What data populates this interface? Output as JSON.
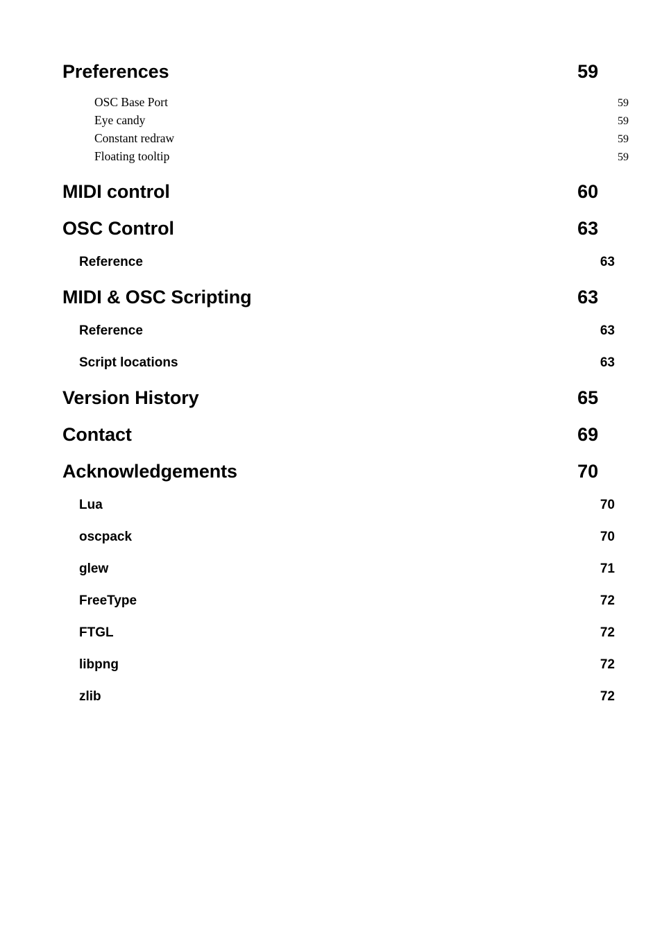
{
  "document": {
    "type": "table-of-contents",
    "background_color": "#ffffff",
    "text_color": "#000000"
  },
  "toc": {
    "entries": [
      {
        "level": 1,
        "label": "Preferences",
        "page": "59"
      },
      {
        "level": 3,
        "label": "OSC Base Port",
        "page": "59"
      },
      {
        "level": 3,
        "label": "Eye candy",
        "page": "59"
      },
      {
        "level": 3,
        "label": "Constant redraw",
        "page": "59"
      },
      {
        "level": 3,
        "label": "Floating tooltip",
        "page": "59"
      },
      {
        "level": 1,
        "label": "MIDI control",
        "page": "60"
      },
      {
        "level": 1,
        "label": "OSC Control",
        "page": "63"
      },
      {
        "level": 2,
        "label": "Reference",
        "page": "63"
      },
      {
        "level": 1,
        "label": "MIDI & OSC Scripting",
        "page": "63"
      },
      {
        "level": 2,
        "label": "Reference",
        "page": "63"
      },
      {
        "level": 2,
        "label": "Script locations",
        "page": "63"
      },
      {
        "level": 1,
        "label": "Version History",
        "page": "65"
      },
      {
        "level": 1,
        "label": "Contact",
        "page": "69"
      },
      {
        "level": 1,
        "label": "Acknowledgements",
        "page": "70"
      },
      {
        "level": 2,
        "label": "Lua",
        "page": "70"
      },
      {
        "level": 2,
        "label": "oscpack",
        "page": "70"
      },
      {
        "level": 2,
        "label": "glew",
        "page": "71"
      },
      {
        "level": 2,
        "label": "FreeType",
        "page": "72"
      },
      {
        "level": 2,
        "label": "FTGL",
        "page": "72"
      },
      {
        "level": 2,
        "label": "libpng",
        "page": "72"
      },
      {
        "level": 2,
        "label": "zlib",
        "page": "72"
      }
    ]
  }
}
